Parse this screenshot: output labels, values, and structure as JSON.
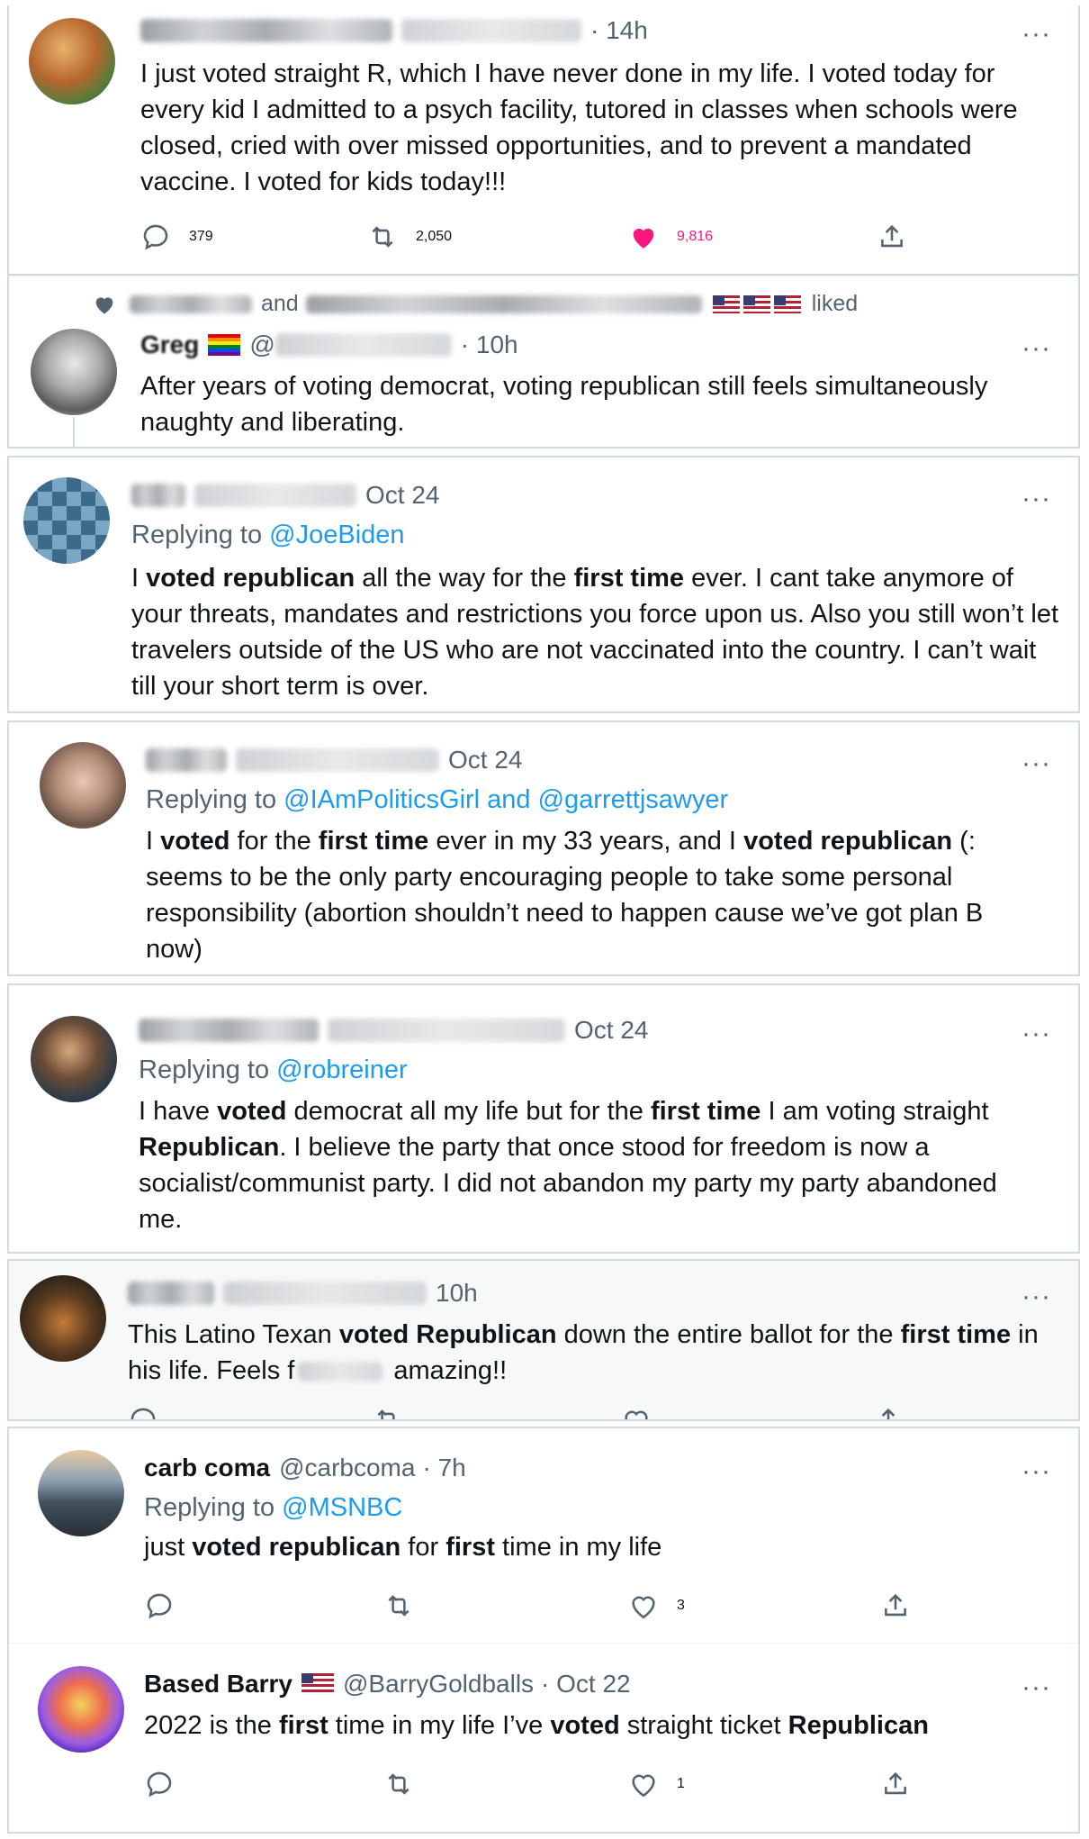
{
  "tweets": [
    {
      "time": "· 14h",
      "more": "···",
      "text": "I just voted straight R, which I have never done in my life. I voted today for every kid I admitted to a psych facility, tutored in classes when schools were closed, cried with over missed opportunities, and to prevent a mandated vaccine. I voted for kids today!!!",
      "replies": "379",
      "retweets": "2,050",
      "likes": "9,816"
    },
    {
      "liked_by_and": "and",
      "liked_suffix": "liked",
      "name": "Greg",
      "handle_prefix": "@",
      "time": "· 10h",
      "more": "···",
      "text": "After years of voting democrat, voting republican still feels simultaneously naughty and liberating."
    },
    {
      "time": "Oct 24",
      "more": "···",
      "replying_label": "Replying to",
      "replying_to": "@JoeBiden",
      "t1": "I ",
      "b1": "voted republican",
      "t2": " all the way for the ",
      "b2": "first time",
      "t3": " ever. I cant take anymore of your threats, mandates and restrictions you force upon us. Also you still won’t let travelers outside of the US who are not vaccinated into the country. I can’t wait till your short term is over."
    },
    {
      "time": "Oct 24",
      "more": "···",
      "replying_label": "Replying to",
      "replying_to": "@IAmPoliticsGirl and @garrettjsawyer",
      "t1": "I ",
      "b1": "voted",
      "t2": " for the ",
      "b2": "first time",
      "t3": " ever in my 33 years, and I ",
      "b3": "voted republican",
      "t4": " (: seems to be the only party encouraging people to take some personal responsibility (abortion shouldn’t need to happen cause we’ve got plan B now)"
    },
    {
      "time": "Oct 24",
      "more": "···",
      "replying_label": "Replying to",
      "replying_to": "@robreiner",
      "t1": "I have ",
      "b1": "voted",
      "t2": " democrat all my life but for the ",
      "b2": "first time",
      "t3": " I am voting straight ",
      "b3": "Republican",
      "t4": ". I believe the party that once stood for freedom is now a socialist/communist party. I did not abandon my party my party abandoned me."
    },
    {
      "time": "10h",
      "more": "···",
      "t1": "This Latino Texan ",
      "b1": "voted Republican",
      "t2": " down the entire ballot for the ",
      "b2": "first time",
      "t3": " in his life. Feels f",
      "t4": " amazing!!"
    },
    {
      "name": "carb coma",
      "handle": "@carbcoma",
      "time": "· 7h",
      "more": "···",
      "replying_label": "Replying to",
      "replying_to": "@MSNBC",
      "t1": "just ",
      "b1": "voted republican",
      "t2": " for ",
      "b2": "first",
      "t3": " time in my life",
      "likes": "3"
    },
    {
      "name": "Based Barry",
      "handle": "@BarryGoldballs",
      "time": "· Oct 22",
      "more": "···",
      "t1": "2022 is the ",
      "b1": "first",
      "t2": " time in my life I’ve ",
      "b2": "voted",
      "t3": " straight ticket ",
      "b3": "Republican",
      "likes": "1"
    }
  ],
  "colors": {
    "like_pink": "#f91880",
    "link_blue": "#1d9bf0",
    "muted": "#536471",
    "border": "#cfd9de"
  }
}
